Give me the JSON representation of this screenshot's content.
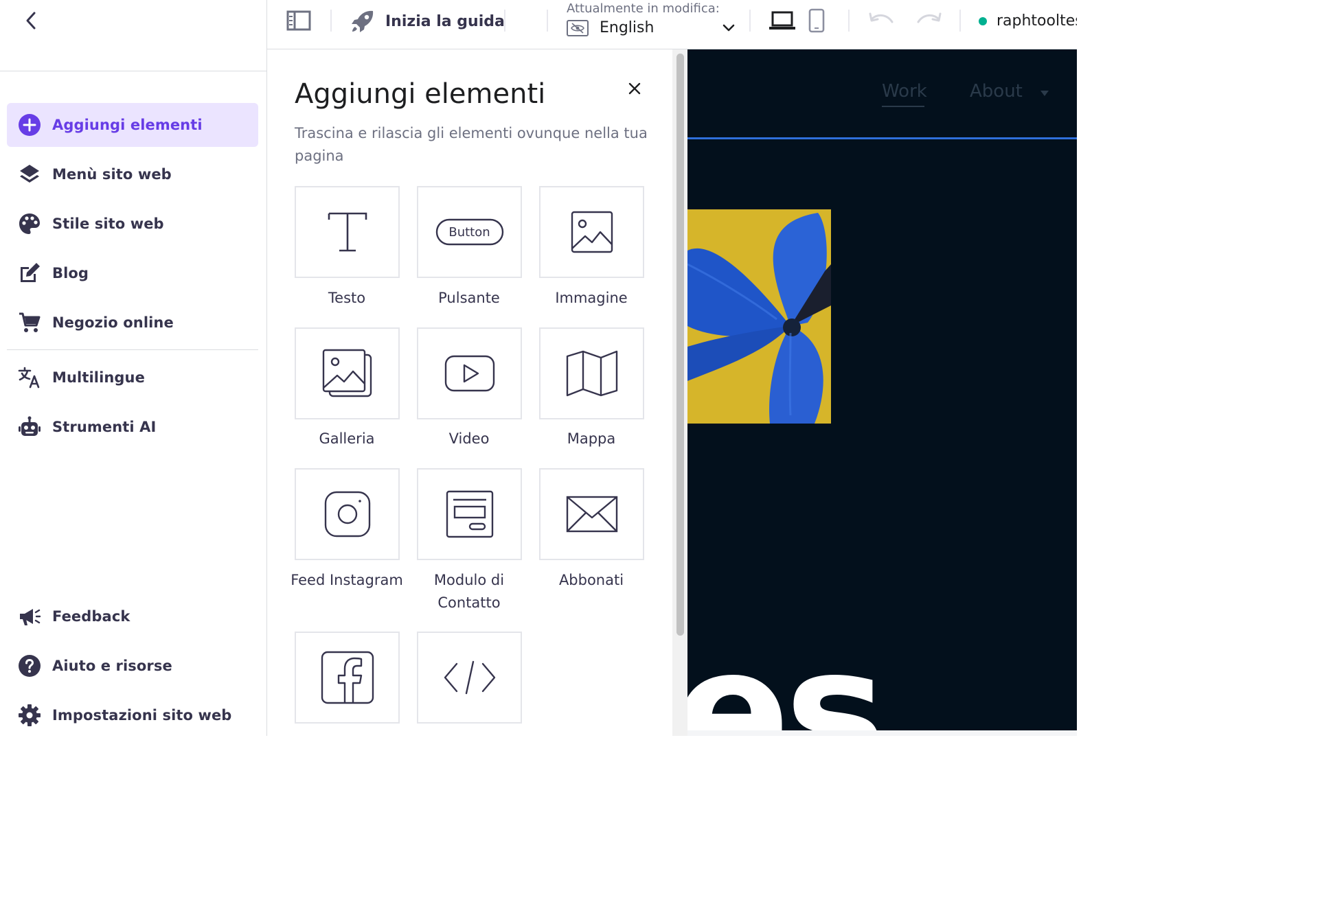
{
  "sidebar": {
    "items": [
      {
        "label": "Aggiungi elementi",
        "icon": "plus-circle-icon"
      },
      {
        "label": "Menù sito web",
        "icon": "layers-icon"
      },
      {
        "label": "Stile sito web",
        "icon": "palette-icon"
      },
      {
        "label": "Blog",
        "icon": "edit-icon"
      },
      {
        "label": "Negozio online",
        "icon": "cart-icon"
      },
      {
        "label": "Multilingue",
        "icon": "translate-icon"
      },
      {
        "label": "Strumenti AI",
        "icon": "robot-icon"
      },
      {
        "label": "Feedback",
        "icon": "megaphone-icon"
      },
      {
        "label": "Aiuto e risorse",
        "icon": "help-icon"
      },
      {
        "label": "Impostazioni sito web",
        "icon": "gear-icon"
      }
    ]
  },
  "toolbar": {
    "guide_label": "Inizia la guida",
    "editing_caption": "Attualmente in modifica:",
    "language": "English",
    "site_name": "raphtooltest"
  },
  "panel": {
    "title": "Aggiungi elementi",
    "subtitle": "Trascina e rilascia gli elementi ovunque nella tua pagina",
    "button_preview_text": "Button",
    "tiles": [
      {
        "label": "Testo",
        "icon": "text-icon"
      },
      {
        "label": "Pulsante",
        "icon": "button-icon"
      },
      {
        "label": "Immagine",
        "icon": "image-icon"
      },
      {
        "label": "Galleria",
        "icon": "gallery-icon"
      },
      {
        "label": "Video",
        "icon": "video-icon"
      },
      {
        "label": "Mappa",
        "icon": "map-icon"
      },
      {
        "label": "Feed Instagram",
        "icon": "instagram-icon"
      },
      {
        "label": "Modulo di Contatto",
        "icon": "contact-form-icon"
      },
      {
        "label": "Abbonati",
        "icon": "envelope-icon"
      },
      {
        "label": "",
        "icon": "facebook-icon"
      },
      {
        "label": "",
        "icon": "code-icon"
      }
    ]
  },
  "preview": {
    "nav": [
      "Work",
      "About"
    ],
    "headline_fragment": "es"
  },
  "colors": {
    "accent": "#673de6",
    "active_bg": "#ebe4ff",
    "preview_bg": "#03101c",
    "status": "#00b090"
  }
}
